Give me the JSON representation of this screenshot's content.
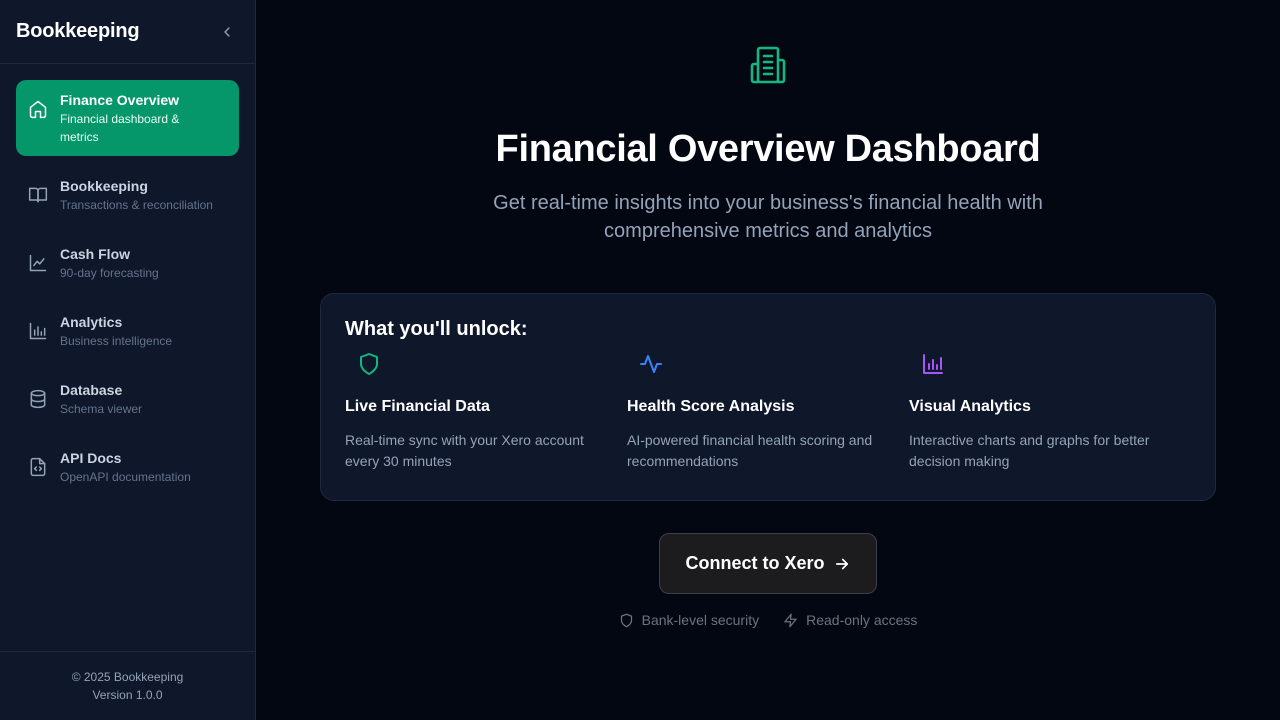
{
  "app": {
    "title": "Bookkeeping"
  },
  "sidebar": {
    "items": [
      {
        "label": "Finance Overview",
        "sub": "Financial dashboard & metrics",
        "icon": "home-icon",
        "active": true
      },
      {
        "label": "Bookkeeping",
        "sub": "Transactions & reconciliation",
        "icon": "book-icon"
      },
      {
        "label": "Cash Flow",
        "sub": "90-day forecasting",
        "icon": "line-chart-icon"
      },
      {
        "label": "Analytics",
        "sub": "Business intelligence",
        "icon": "bar-chart-icon"
      },
      {
        "label": "Database",
        "sub": "Schema viewer",
        "icon": "database-icon"
      },
      {
        "label": "API Docs",
        "sub": "OpenAPI documentation",
        "icon": "code-file-icon"
      }
    ],
    "footer": {
      "copyright": "© 2025 Bookkeeping",
      "version": "Version 1.0.0"
    }
  },
  "hero": {
    "icon": "building-icon",
    "title": "Financial Overview Dashboard",
    "subtitle": "Get real-time insights into your business's financial health with comprehensive metrics and analytics"
  },
  "unlock": {
    "title": "What you'll unlock:",
    "features": [
      {
        "icon": "shield-icon",
        "title": "Live Financial Data",
        "desc": "Real-time sync with your Xero account every 30 minutes",
        "color": "#10b981"
      },
      {
        "icon": "activity-icon",
        "title": "Health Score Analysis",
        "desc": "AI-powered financial health scoring and recommendations",
        "color": "#3b82f6"
      },
      {
        "icon": "bar-chart-icon",
        "title": "Visual Analytics",
        "desc": "Interactive charts and graphs for better decision making",
        "color": "#a855f7"
      }
    ]
  },
  "cta": {
    "label": "Connect to Xero"
  },
  "trust": [
    {
      "icon": "shield-icon",
      "label": "Bank-level security"
    },
    {
      "icon": "zap-icon",
      "label": "Read-only access"
    }
  ],
  "colors": {
    "accent": "#059669",
    "background": "#030712",
    "sidebar": "#0f172a"
  }
}
